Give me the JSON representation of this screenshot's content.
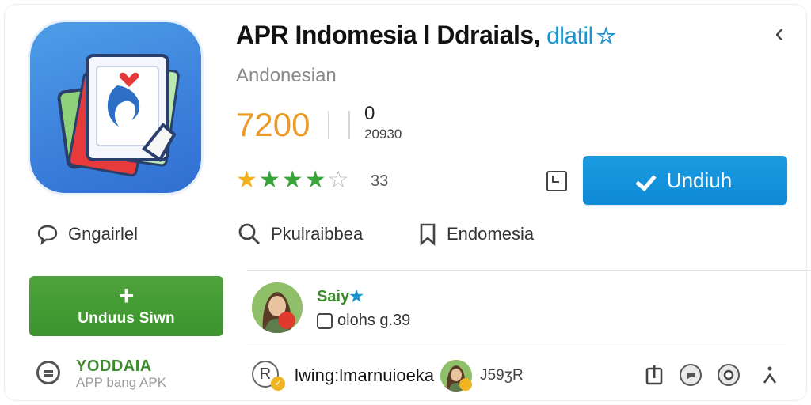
{
  "app": {
    "title": "APR Indomesia l Ddraials,",
    "title_link": "dlatil",
    "subtitle": "Andonesian",
    "stat_main": "7200",
    "stat_secondary_value": "0",
    "stat_secondary_label": "20930",
    "rating_stars": 4,
    "rating_count": "33",
    "install_label": "Undiuh"
  },
  "info_row": [
    {
      "icon": "chat-bubble-icon",
      "label": "Gngairlel"
    },
    {
      "icon": "search-icon",
      "label": "Pkulraibbea"
    },
    {
      "icon": "bookmark-icon",
      "label": "Endomesia"
    }
  ],
  "download_button": {
    "label": "Unduus Siwn"
  },
  "review": {
    "user_name": "Saiy",
    "meta": "olohs g.39"
  },
  "footer": {
    "brand_top": "YODDAIA",
    "brand_bottom": "APP bang APK",
    "user_text": "lwing:lmarnuioeka",
    "number": "J59ʒR",
    "r_icon_char": "R"
  },
  "colors": {
    "accent_blue": "#0f8ad6",
    "accent_green": "#3d932e",
    "stat_orange": "#e99a28",
    "icon_bg": "#3b7fdb"
  }
}
